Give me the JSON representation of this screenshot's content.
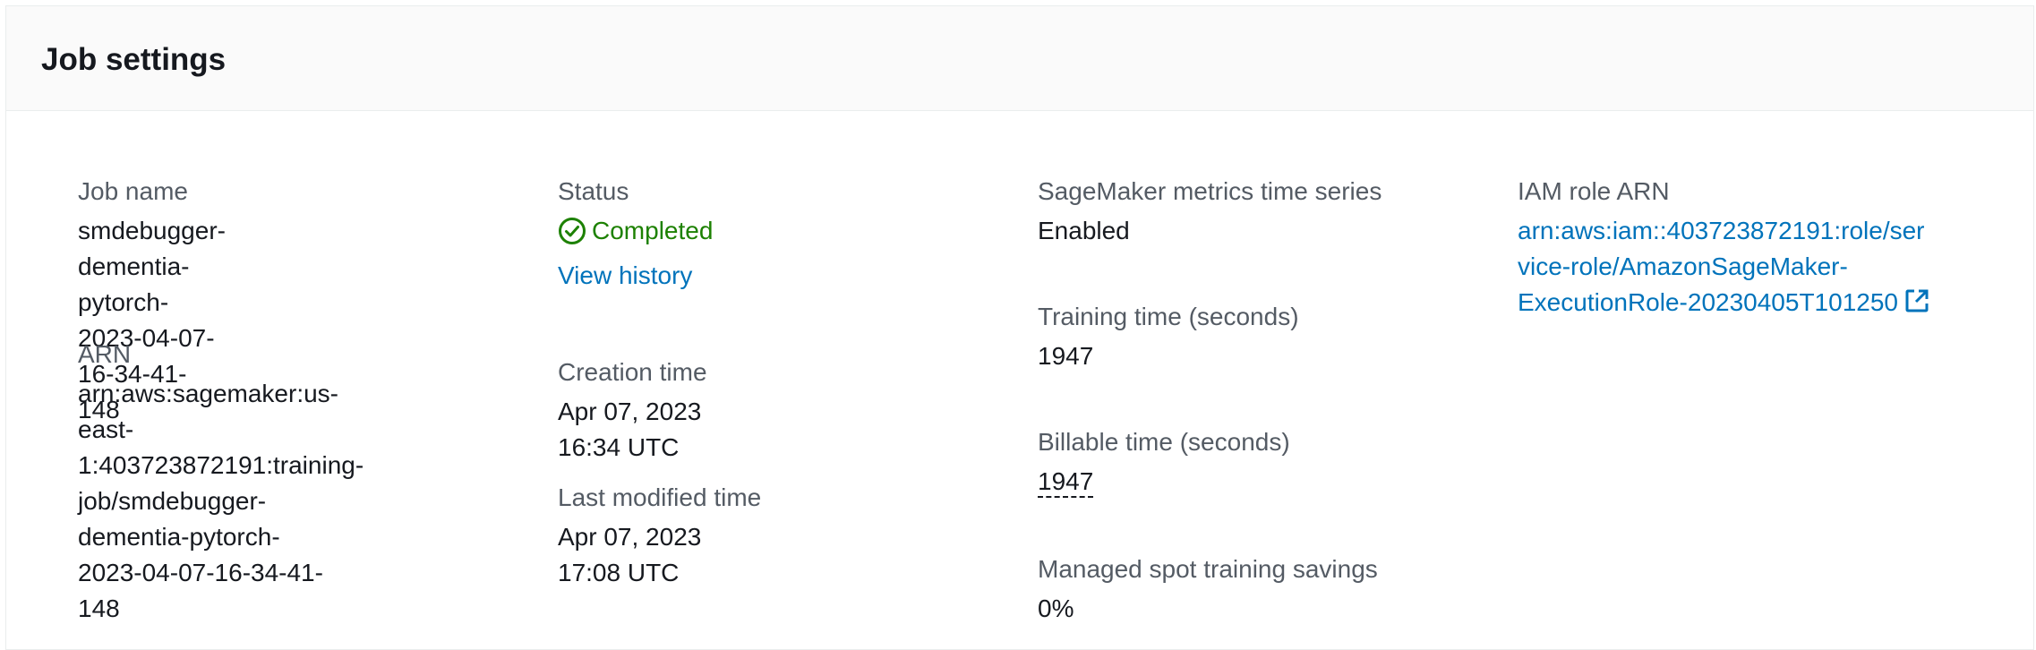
{
  "panel": {
    "title": "Job settings"
  },
  "job_name": {
    "label": "Job name",
    "line1": "smdebugger-dementia-pytorch-",
    "line2": "2023-04-07-16-34-41-148"
  },
  "arn": {
    "label": "ARN",
    "line1": "arn:aws:sagemaker:us-east-",
    "line2": "1:403723872191:training-",
    "line3": "job/smdebugger-dementia-pytorch-",
    "line4": "2023-04-07-16-34-41-148"
  },
  "status": {
    "label": "Status",
    "value": "Completed",
    "icon": "check-circle-icon",
    "color": "#1d8102",
    "view_history": "View history"
  },
  "creation_time": {
    "label": "Creation time",
    "value": "Apr 07, 2023 16:34 UTC"
  },
  "last_modified_time": {
    "label": "Last modified time",
    "value": "Apr 07, 2023 17:08 UTC"
  },
  "metrics_time_series": {
    "label": "SageMaker metrics time series",
    "value": "Enabled"
  },
  "training_time": {
    "label": "Training time (seconds)",
    "value": "1947"
  },
  "billable_time": {
    "label": "Billable time (seconds)",
    "value": "1947"
  },
  "spot_savings": {
    "label": "Managed spot training savings",
    "value": "0%"
  },
  "iam_role": {
    "label": "IAM role ARN",
    "line1": "arn:aws:iam::403723872191:role/ser",
    "line2": "vice-role/AmazonSageMaker-",
    "line3": "ExecutionRole-20230405T101250",
    "icon": "external-link-icon"
  },
  "colors": {
    "link": "#0073bb",
    "success": "#1d8102",
    "label": "#545b64",
    "text": "#16191f"
  }
}
